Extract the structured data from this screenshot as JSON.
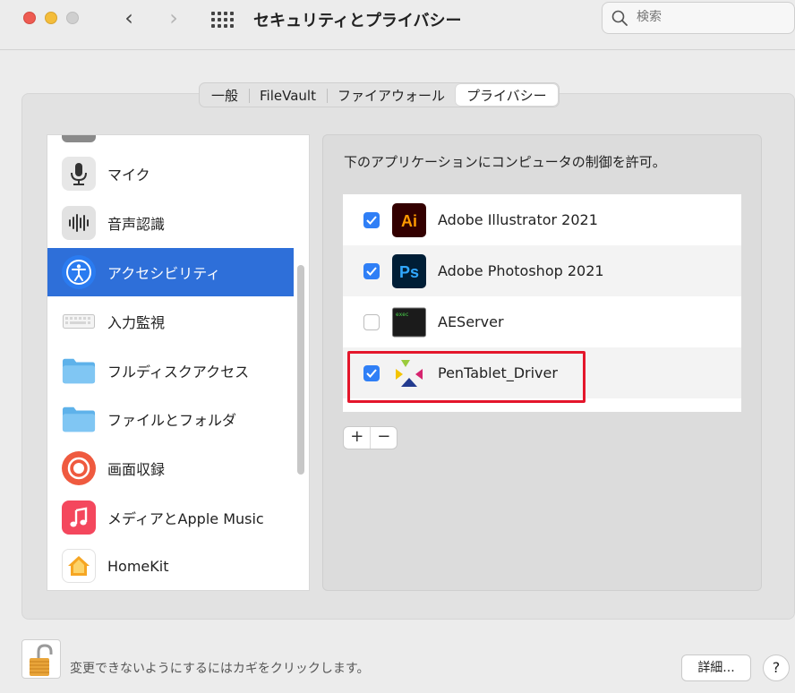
{
  "window": {
    "title": "セキュリティとプライバシー",
    "search_placeholder": "検索",
    "nav_back": "‹",
    "nav_forward": "›"
  },
  "tabs": [
    {
      "label": "一般",
      "active": false
    },
    {
      "label": "FileVault",
      "active": false
    },
    {
      "label": "ファイアウォール",
      "active": false
    },
    {
      "label": "プライバシー",
      "active": true
    }
  ],
  "sidebar": {
    "items": [
      {
        "label": "マイク",
        "icon": "microphone-icon"
      },
      {
        "label": "音声認識",
        "icon": "speech-recognition-icon"
      },
      {
        "label": "アクセシビリティ",
        "icon": "accessibility-icon",
        "selected": true
      },
      {
        "label": "入力監視",
        "icon": "keyboard-icon"
      },
      {
        "label": "フルディスクアクセス",
        "icon": "folder-icon"
      },
      {
        "label": "ファイルとフォルダ",
        "icon": "folder-icon"
      },
      {
        "label": "画面収録",
        "icon": "screen-recording-icon"
      },
      {
        "label": "メディアとApple Music",
        "icon": "music-icon"
      },
      {
        "label": "HomeKit",
        "icon": "home-icon"
      }
    ]
  },
  "right_pane": {
    "description": "下のアプリケーションにコンピュータの制御を許可。",
    "apps": [
      {
        "name": "Adobe Illustrator 2021",
        "checked": true,
        "icon_text": "Ai"
      },
      {
        "name": "Adobe Photoshop 2021",
        "checked": true,
        "icon_text": "Ps"
      },
      {
        "name": "AEServer",
        "checked": false,
        "icon_text": "exec"
      },
      {
        "name": "PenTablet_Driver",
        "checked": true
      }
    ],
    "add_label": "+",
    "remove_label": "−"
  },
  "footer": {
    "lock_text": "変更できないようにするにはカギをクリックします。",
    "advanced_label": "詳細...",
    "help_label": "?"
  },
  "colors": {
    "selection": "#2e6fd9",
    "checkbox": "#2f7ff6",
    "highlight": "#e4162b"
  }
}
